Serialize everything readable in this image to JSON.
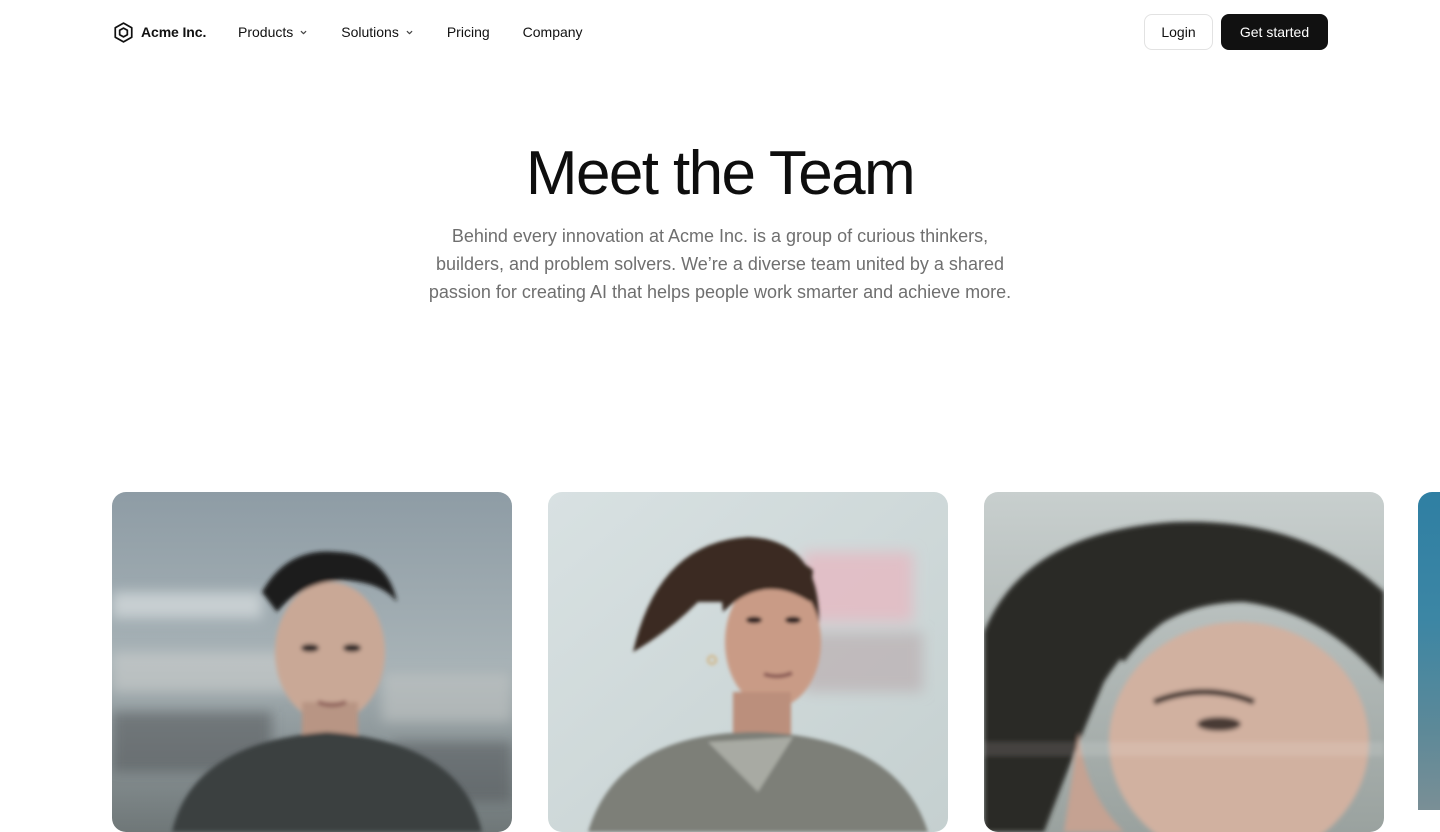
{
  "nav": {
    "brand": "Acme Inc.",
    "menu": [
      {
        "label": "Products",
        "has_dropdown": true
      },
      {
        "label": "Solutions",
        "has_dropdown": true
      },
      {
        "label": "Pricing",
        "has_dropdown": false
      },
      {
        "label": "Company",
        "has_dropdown": false
      }
    ],
    "login_label": "Login",
    "cta_label": "Get started"
  },
  "hero": {
    "title": "Meet the Team",
    "description": "Behind every innovation at Acme Inc. is a group of curious thinkers, builders, and problem solvers. We’re a diverse team united by a shared passion for creating AI that helps people work smarter and achieve more."
  },
  "team": {
    "photos": [
      {
        "icon": "team-member-photo-1"
      },
      {
        "icon": "team-member-photo-2"
      },
      {
        "icon": "team-member-photo-3"
      },
      {
        "icon": "team-member-photo-4"
      }
    ]
  },
  "colors": {
    "text": "#111111",
    "muted": "#6f6f6f",
    "cta_bg": "#111111",
    "border": "#e2e2e2"
  }
}
